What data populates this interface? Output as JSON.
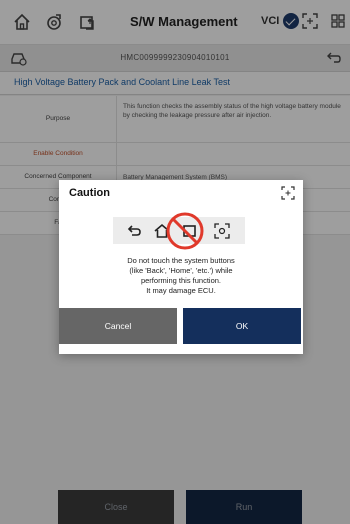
{
  "header": {
    "title": "S/W Management",
    "vci_label": "VCI",
    "icons": [
      "home-icon",
      "diagnosis-icon",
      "vehicle-upload-icon",
      "vci-status-icon",
      "fullscreen-icon",
      "grid-menu-icon"
    ]
  },
  "vehicle": {
    "vin": "HMC0099999230904010101",
    "icons": [
      "car-icon",
      "back-icon"
    ]
  },
  "page_title": "High Voltage Battery Pack and Coolant Line Leak Test",
  "table": {
    "rows": [
      {
        "label": "Purpose",
        "value": "This function checks the assembly status of the high voltage battery module by checking the leakage pressure after air injection."
      },
      {
        "label": "Enable Condition",
        "value": ""
      },
      {
        "label": "Concerned Component",
        "value": "Battery Management System (BMS)"
      },
      {
        "label": "Conce",
        "value": ""
      },
      {
        "label": "Fa",
        "value": ""
      }
    ]
  },
  "footer": {
    "close_label": "Close",
    "run_label": "Run"
  },
  "dialog": {
    "title": "Caution",
    "message_lines": [
      "Do not touch the system buttons",
      "(like 'Back', 'Home', 'etc.') while",
      "performing this function.",
      "It may damage ECU."
    ],
    "cancel_label": "Cancel",
    "ok_label": "OK"
  },
  "colors": {
    "accent": "#142f5c",
    "title_link": "#1b5fa6",
    "enable_condition": "#c0502a",
    "prohibit": "#e0392b"
  }
}
